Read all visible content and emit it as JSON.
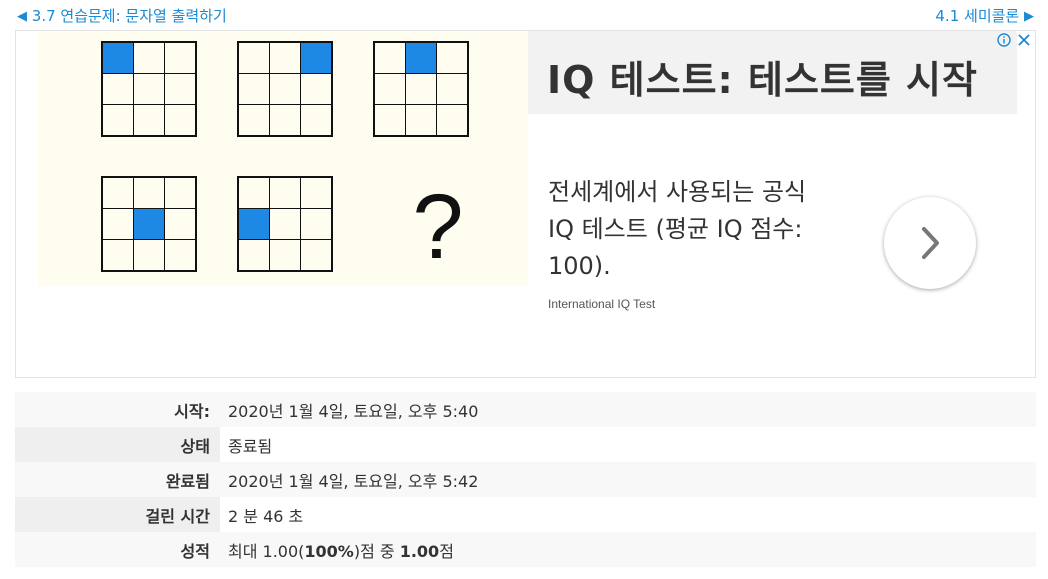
{
  "nav": {
    "prev_label": "3.7 연습문제: 문자열 출력하기",
    "next_label": "4.1 세미콜론"
  },
  "ad": {
    "title": "IQ 테스트: 테스트를 시작",
    "description": "전세계에서 사용되는 공식 IQ 테스트 (평균 IQ 점수: 100).",
    "source": "International IQ Test",
    "ad_choices_icon": "info-circle-icon",
    "close_icon": "close-icon",
    "arrow_icon": "chevron-right-icon",
    "accent_color": "#1e88e5",
    "puzzle": {
      "highlighted_cells": [
        0,
        2,
        1,
        4,
        3
      ],
      "question_mark": "?"
    }
  },
  "summary": {
    "rows": [
      {
        "label": "시작:",
        "value": "2020년 1월 4일, 토요일, 오후 5:40"
      },
      {
        "label": "상태",
        "value": "종료됨"
      },
      {
        "label": "완료됨",
        "value": "2020년 1월 4일, 토요일, 오후 5:42"
      },
      {
        "label": "걸린 시간",
        "value": "2 분 46 초"
      }
    ],
    "grade": {
      "label": "성적",
      "prefix": "최대 1.00(",
      "percent": "100%",
      "middle": ")점 중 ",
      "score": "1.00",
      "suffix": "점"
    }
  }
}
